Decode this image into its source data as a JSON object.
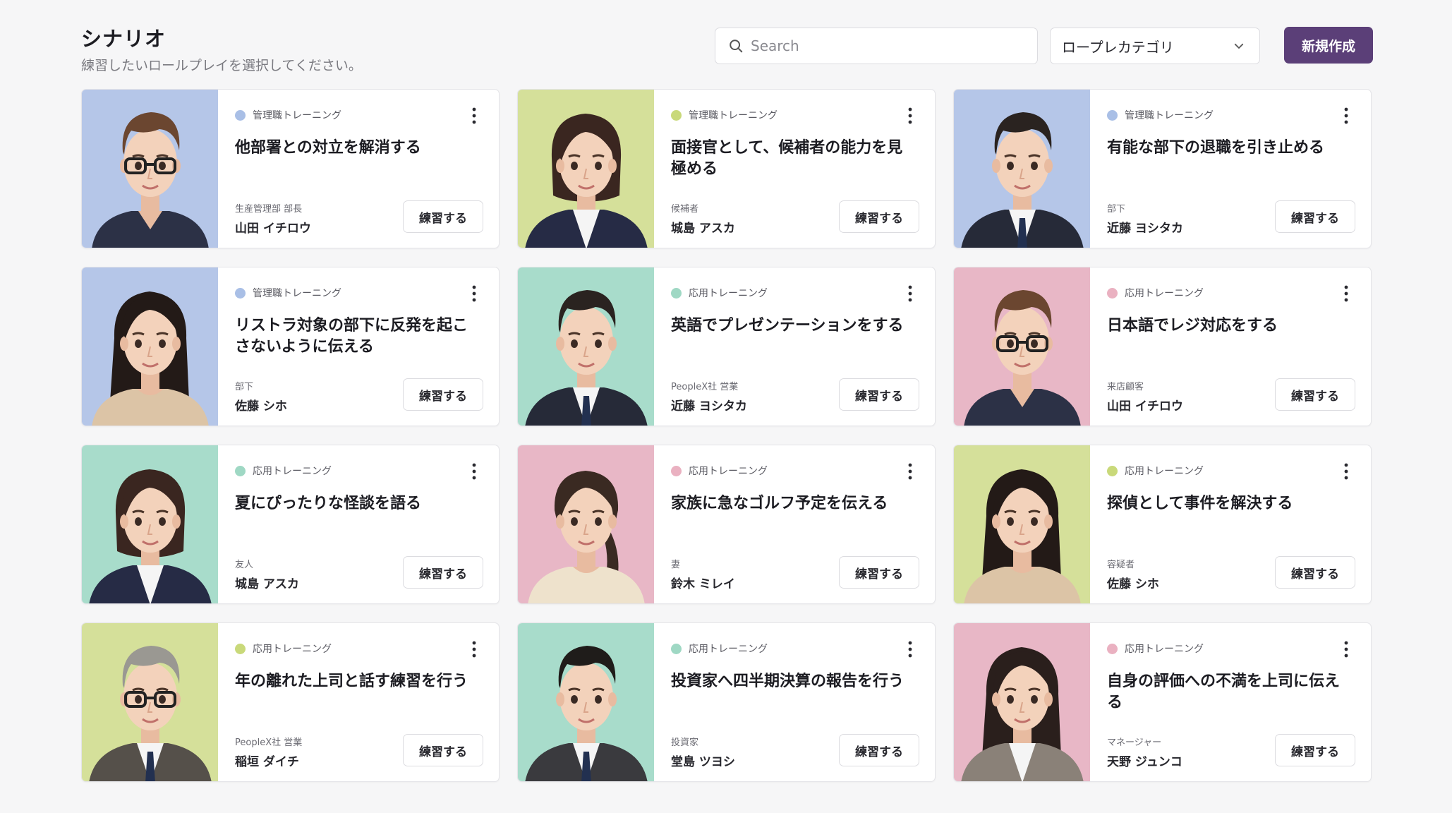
{
  "header": {
    "title": "シナリオ",
    "subtitle": "練習したいロールプレイを選択してください。",
    "search_placeholder": "Search",
    "category_select": "ロープレカテゴリ",
    "new_button": "新規作成"
  },
  "colors": {
    "blue": "#b5c6e8",
    "lime": "#d5e09a",
    "mint": "#a8dccb",
    "pink": "#e8b7c6",
    "dot_blue": "#a9bfe6",
    "dot_lime": "#c9d97a",
    "dot_mint": "#9fd8c4",
    "dot_pink": "#eab1c1",
    "accent": "#5b3f78"
  },
  "cards": [
    {
      "category": "管理職トレーニング",
      "dot": "dot_blue",
      "bg": "blue",
      "avatar": "man-glasses-avatar",
      "title": "他部署との対立を解消する",
      "role": "生産管理部 部長",
      "name": "山田 イチロウ",
      "button": "練習する"
    },
    {
      "category": "管理職トレーニング",
      "dot": "dot_lime",
      "bg": "lime",
      "avatar": "woman-bob-avatar",
      "title": "面接官として、候補者の能力を見極める",
      "role": "候補者",
      "name": "城島 アスカ",
      "button": "練習する"
    },
    {
      "category": "管理職トレーニング",
      "dot": "dot_blue",
      "bg": "blue",
      "avatar": "young-man-suit-avatar",
      "title": "有能な部下の退職を引き止める",
      "role": "部下",
      "name": "近藤 ヨシタカ",
      "button": "練習する"
    },
    {
      "category": "管理職トレーニング",
      "dot": "dot_blue",
      "bg": "blue",
      "avatar": "woman-long-hair-avatar",
      "title": "リストラ対象の部下に反発を起こさないように伝える",
      "role": "部下",
      "name": "佐藤 シホ",
      "button": "練習する"
    },
    {
      "category": "応用トレーニング",
      "dot": "dot_mint",
      "bg": "mint",
      "avatar": "young-man-suit-avatar",
      "title": "英語でプレゼンテーションをする",
      "role": "PeopleX社 営業",
      "name": "近藤 ヨシタカ",
      "button": "練習する"
    },
    {
      "category": "応用トレーニング",
      "dot": "dot_pink",
      "bg": "pink",
      "avatar": "man-glasses-avatar",
      "title": "日本語でレジ対応をする",
      "role": "来店顧客",
      "name": "山田 イチロウ",
      "button": "練習する"
    },
    {
      "category": "応用トレーニング",
      "dot": "dot_mint",
      "bg": "mint",
      "avatar": "woman-bob-avatar",
      "title": "夏にぴったりな怪談を語る",
      "role": "友人",
      "name": "城島 アスカ",
      "button": "練習する"
    },
    {
      "category": "応用トレーニング",
      "dot": "dot_pink",
      "bg": "pink",
      "avatar": "woman-ponytail-avatar",
      "title": "家族に急なゴルフ予定を伝える",
      "role": "妻",
      "name": "鈴木 ミレイ",
      "button": "練習する"
    },
    {
      "category": "応用トレーニング",
      "dot": "dot_lime",
      "bg": "lime",
      "avatar": "woman-long-hair-avatar",
      "title": "探偵として事件を解決する",
      "role": "容疑者",
      "name": "佐藤 シホ",
      "button": "練習する"
    },
    {
      "category": "応用トレーニング",
      "dot": "dot_lime",
      "bg": "lime",
      "avatar": "older-man-glasses-avatar",
      "title": "年の離れた上司と話す練習を行う",
      "role": "PeopleX社 営業",
      "name": "稲垣 ダイチ",
      "button": "練習する"
    },
    {
      "category": "応用トレーニング",
      "dot": "dot_mint",
      "bg": "mint",
      "avatar": "smiling-man-suit-avatar",
      "title": "投資家へ四半期決算の報告を行う",
      "role": "投資家",
      "name": "堂島 ツヨシ",
      "button": "練習する"
    },
    {
      "category": "応用トレーニング",
      "dot": "dot_pink",
      "bg": "pink",
      "avatar": "woman-manager-avatar",
      "title": "自身の評価への不満を上司に伝える",
      "role": "マネージャー",
      "name": "天野 ジュンコ",
      "button": "練習する"
    }
  ]
}
